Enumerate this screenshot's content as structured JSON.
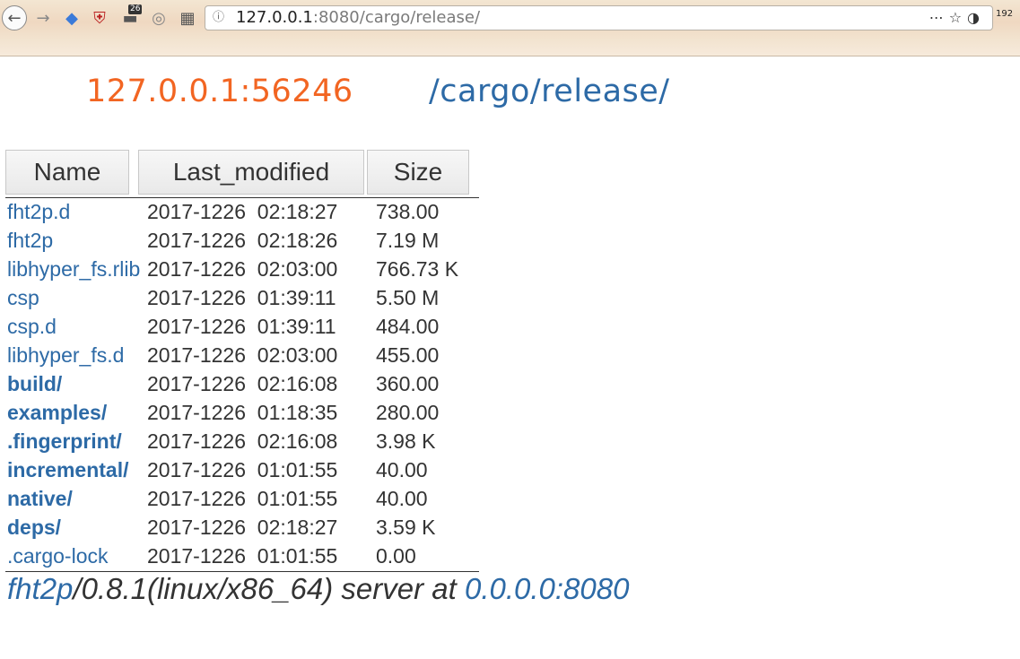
{
  "browser": {
    "url_host": "127.0.0.1",
    "url_rest": ":8080/cargo/release/",
    "badge_count": "26",
    "menu_label": "192"
  },
  "page": {
    "host": "127.0.0.1:56246",
    "path": "/cargo/release/"
  },
  "table": {
    "headers": {
      "name": "Name",
      "modified": "Last_modified",
      "size": "Size"
    },
    "rows": [
      {
        "name": "fht2p.d",
        "dir": false,
        "modified": "2017-1226  02:18:27",
        "size": "738.00"
      },
      {
        "name": "fht2p",
        "dir": false,
        "modified": "2017-1226  02:18:26",
        "size": "7.19 M"
      },
      {
        "name": "libhyper_fs.rlib",
        "dir": false,
        "modified": "2017-1226  02:03:00",
        "size": "766.73 K"
      },
      {
        "name": "csp",
        "dir": false,
        "modified": "2017-1226  01:39:11",
        "size": "5.50 M"
      },
      {
        "name": "csp.d",
        "dir": false,
        "modified": "2017-1226  01:39:11",
        "size": "484.00"
      },
      {
        "name": "libhyper_fs.d",
        "dir": false,
        "modified": "2017-1226  02:03:00",
        "size": "455.00"
      },
      {
        "name": "build/",
        "dir": true,
        "modified": "2017-1226  02:16:08",
        "size": "360.00"
      },
      {
        "name": "examples/",
        "dir": true,
        "modified": "2017-1226  01:18:35",
        "size": "280.00"
      },
      {
        "name": ".fingerprint/",
        "dir": true,
        "modified": "2017-1226  02:16:08",
        "size": "3.98 K"
      },
      {
        "name": "incremental/",
        "dir": true,
        "modified": "2017-1226  01:01:55",
        "size": "40.00"
      },
      {
        "name": "native/",
        "dir": true,
        "modified": "2017-1226  01:01:55",
        "size": "40.00"
      },
      {
        "name": "deps/",
        "dir": true,
        "modified": "2017-1226  02:18:27",
        "size": "3.59 K"
      },
      {
        "name": ".cargo-lock",
        "dir": false,
        "modified": "2017-1226  01:01:55",
        "size": "0.00"
      }
    ]
  },
  "footer": {
    "server_link": "fht2p",
    "server_info": "/0.8.1(linux/x86_64) server at ",
    "address_link": "0.0.0.0:8080"
  }
}
